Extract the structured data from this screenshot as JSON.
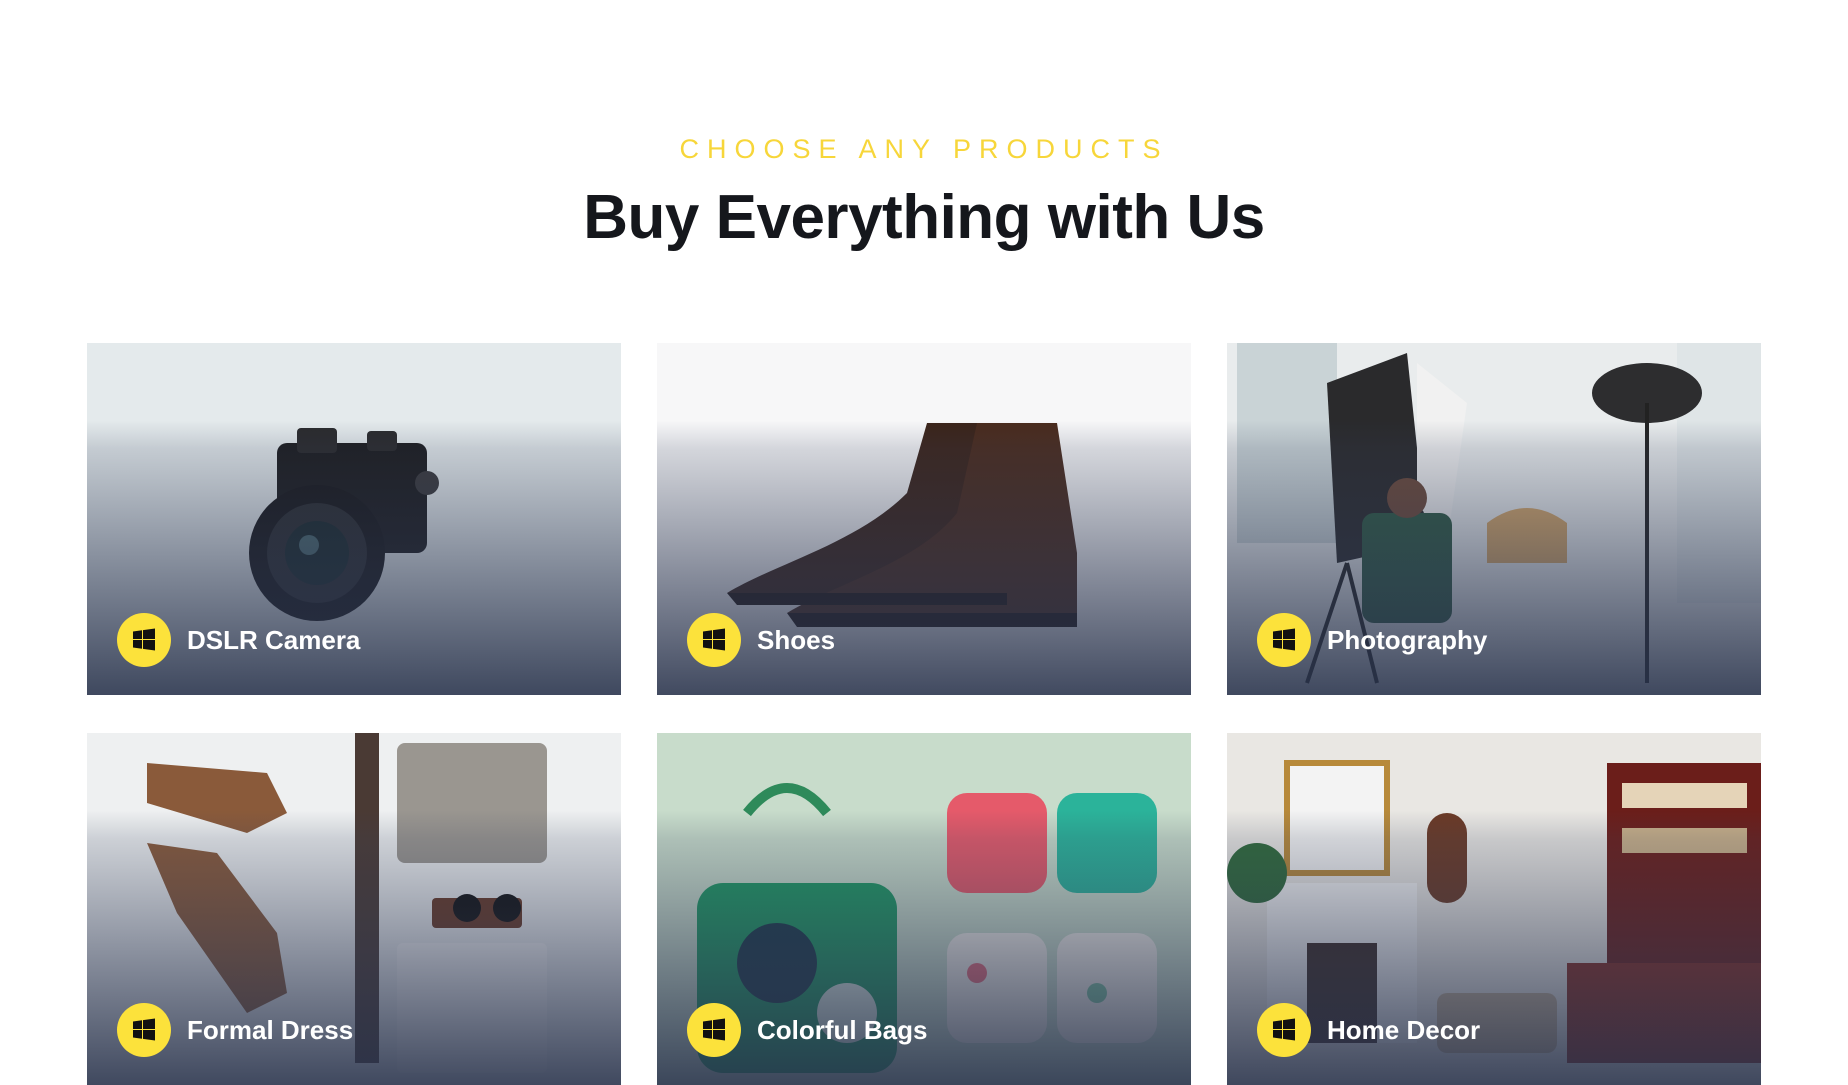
{
  "section": {
    "eyebrow": "CHOOSE ANY PRODUCTS",
    "title": "Buy Everything with Us"
  },
  "cards": [
    {
      "label": "DSLR Camera",
      "icon": "windows-icon",
      "bg": "#e6ecee"
    },
    {
      "label": "Shoes",
      "icon": "windows-icon",
      "bg": "#f6f6f7"
    },
    {
      "label": "Photography",
      "icon": "windows-icon",
      "bg": "#e9eced"
    },
    {
      "label": "Formal Dress",
      "icon": "windows-icon",
      "bg": "#eef0f1"
    },
    {
      "label": "Colorful Bags",
      "icon": "windows-icon",
      "bg": "#c6d9c9"
    },
    {
      "label": "Home Decor",
      "icon": "windows-icon",
      "bg": "#e8e6e2"
    }
  ],
  "colors": {
    "accent": "#fce23b",
    "eyebrow": "#f7d63a",
    "heading": "#15171c"
  }
}
